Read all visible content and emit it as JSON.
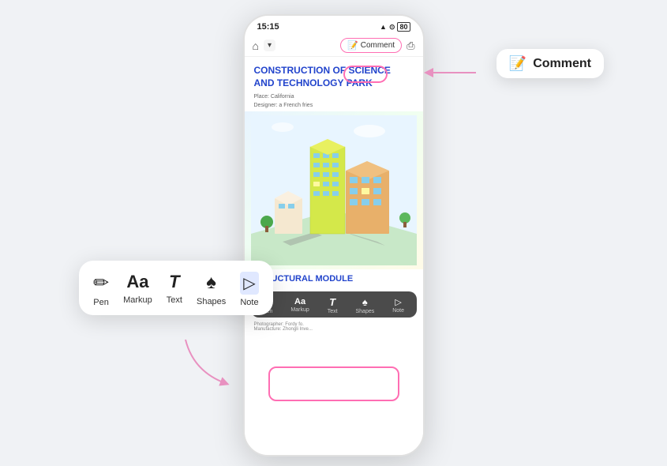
{
  "statusBar": {
    "time": "15:15",
    "signal": "▲▲▲",
    "wifi": "WiFi",
    "battery": "80"
  },
  "appBar": {
    "homeIcon": "⌂",
    "dropdownArrow": "▾",
    "commentLabel": "Comment",
    "commentEmoji": "📝",
    "screenshotIcon": "⎙"
  },
  "book": {
    "title": "CONSTRUCTION OF SCIENCE AND TECHNOLOGY PARK",
    "meta1": "Place: California",
    "meta2": "Designer: a French fries",
    "sectionTitle": "STRUCTURAL MODULE",
    "credit1": "Photographer: Fordy fo.",
    "credit2": "Manufacture: Zhongli Inve..."
  },
  "toolbar": {
    "tools": [
      {
        "id": "pen",
        "icon": "✏",
        "label": "Pen"
      },
      {
        "id": "markup",
        "icon": "Aa",
        "label": "Markup"
      },
      {
        "id": "text",
        "icon": "T",
        "label": "Text"
      },
      {
        "id": "shapes",
        "icon": "♠",
        "label": "Shapes"
      },
      {
        "id": "note",
        "icon": "▷",
        "label": "Note"
      }
    ]
  },
  "commentTooltip": {
    "emoji": "📝",
    "label": "Comment"
  },
  "colors": {
    "accent": "#2244cc",
    "pink": "#ff6eb3",
    "toolbarBg": "#fff",
    "phoneBg": "#fff"
  }
}
